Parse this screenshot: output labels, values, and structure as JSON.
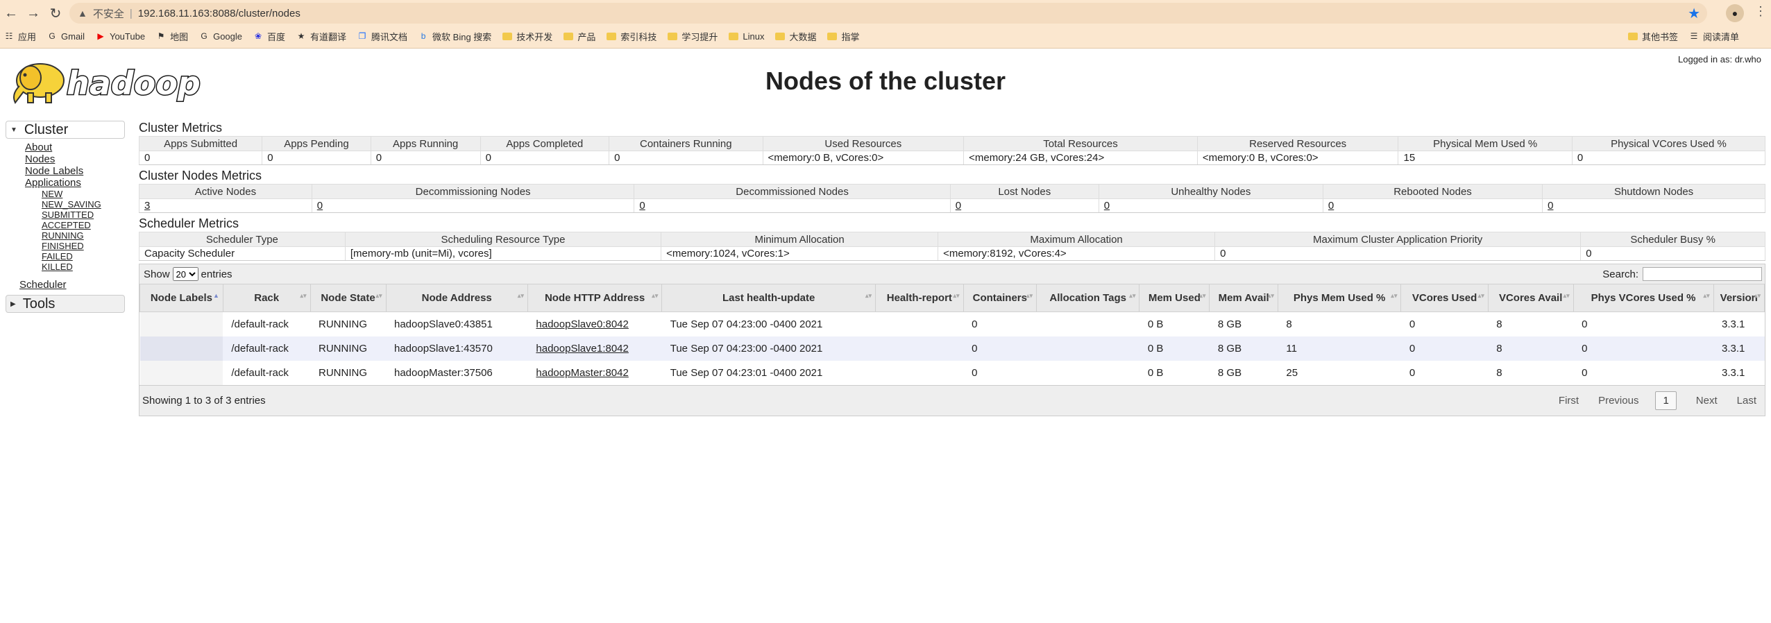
{
  "browser": {
    "insecure_label": "不安全",
    "url": "192.168.11.163:8088/cluster/nodes",
    "bookmarks": [
      {
        "icon": "apps-grid-icon",
        "label": "应用"
      },
      {
        "icon": "google-g-icon",
        "label": "Gmail"
      },
      {
        "icon": "youtube-icon",
        "label": "YouTube"
      },
      {
        "icon": "map-icon",
        "label": "地图"
      },
      {
        "icon": "google-g-icon",
        "label": "Google"
      },
      {
        "icon": "baidu-icon",
        "label": "百度"
      },
      {
        "icon": "youdao-icon",
        "label": "有道翻译"
      },
      {
        "icon": "tencent-docs-icon",
        "label": "腾讯文档"
      },
      {
        "icon": "bing-icon",
        "label": "微软 Bing 搜索"
      },
      {
        "icon": "folder-icon",
        "label": "技术开发"
      },
      {
        "icon": "folder-icon",
        "label": "产品"
      },
      {
        "icon": "folder-icon",
        "label": "索引科技"
      },
      {
        "icon": "folder-icon",
        "label": "学习提升"
      },
      {
        "icon": "folder-icon",
        "label": "Linux"
      },
      {
        "icon": "folder-icon",
        "label": "大数据"
      },
      {
        "icon": "folder-icon",
        "label": "指掌"
      }
    ],
    "bookmarks_right": [
      {
        "icon": "folder-icon",
        "label": "其他书签"
      },
      {
        "icon": "reading-list-icon",
        "label": "阅读清单"
      }
    ]
  },
  "header": {
    "logo_text": "hadoop",
    "title": "Nodes of the cluster",
    "logged_in": "Logged in as: dr.who"
  },
  "sidebar": {
    "cluster_label": "Cluster",
    "links": [
      "About",
      "Nodes",
      "Node Labels",
      "Applications"
    ],
    "app_states": [
      "NEW",
      "NEW_SAVING",
      "SUBMITTED",
      "ACCEPTED",
      "RUNNING",
      "FINISHED",
      "FAILED",
      "KILLED"
    ],
    "scheduler_label": "Scheduler",
    "tools_label": "Tools"
  },
  "cluster_metrics": {
    "title": "Cluster Metrics",
    "headers": [
      "Apps Submitted",
      "Apps Pending",
      "Apps Running",
      "Apps Completed",
      "Containers Running",
      "Used Resources",
      "Total Resources",
      "Reserved Resources",
      "Physical Mem Used %",
      "Physical VCores Used %"
    ],
    "values": [
      "0",
      "0",
      "0",
      "0",
      "0",
      "<memory:0 B, vCores:0>",
      "<memory:24 GB, vCores:24>",
      "<memory:0 B, vCores:0>",
      "15",
      "0"
    ]
  },
  "cluster_nodes_metrics": {
    "title": "Cluster Nodes Metrics",
    "headers": [
      "Active Nodes",
      "Decommissioning Nodes",
      "Decommissioned Nodes",
      "Lost Nodes",
      "Unhealthy Nodes",
      "Rebooted Nodes",
      "Shutdown Nodes"
    ],
    "values": [
      "3",
      "0",
      "0",
      "0",
      "0",
      "0",
      "0"
    ]
  },
  "scheduler_metrics": {
    "title": "Scheduler Metrics",
    "headers": [
      "Scheduler Type",
      "Scheduling Resource Type",
      "Minimum Allocation",
      "Maximum Allocation",
      "Maximum Cluster Application Priority",
      "Scheduler Busy %"
    ],
    "values": [
      "Capacity Scheduler",
      "[memory-mb (unit=Mi), vcores]",
      "<memory:1024, vCores:1>",
      "<memory:8192, vCores:4>",
      "0",
      "0"
    ]
  },
  "nodes_table": {
    "show_label": "Show",
    "page_size": "20",
    "entries_label": "entries",
    "search_label": "Search:",
    "search_value": "",
    "columns": [
      "Node Labels",
      "Rack",
      "Node State",
      "Node Address",
      "Node HTTP Address",
      "Last health-update",
      "Health-report",
      "Containers",
      "Allocation Tags",
      "Mem Used",
      "Mem Avail",
      "Phys Mem Used %",
      "VCores Used",
      "VCores Avail",
      "Phys VCores Used %",
      "Version"
    ],
    "rows": [
      [
        "",
        "/default-rack",
        "RUNNING",
        "hadoopSlave0:43851",
        "hadoopSlave0:8042",
        "Tue Sep 07 04:23:00 -0400 2021",
        "",
        "0",
        "",
        "0 B",
        "8 GB",
        "8",
        "0",
        "8",
        "0",
        "3.3.1"
      ],
      [
        "",
        "/default-rack",
        "RUNNING",
        "hadoopSlave1:43570",
        "hadoopSlave1:8042",
        "Tue Sep 07 04:23:00 -0400 2021",
        "",
        "0",
        "",
        "0 B",
        "8 GB",
        "11",
        "0",
        "8",
        "0",
        "3.3.1"
      ],
      [
        "",
        "/default-rack",
        "RUNNING",
        "hadoopMaster:37506",
        "hadoopMaster:8042",
        "Tue Sep 07 04:23:01 -0400 2021",
        "",
        "0",
        "",
        "0 B",
        "8 GB",
        "25",
        "0",
        "8",
        "0",
        "3.3.1"
      ]
    ],
    "info": "Showing 1 to 3 of 3 entries",
    "pager": {
      "first": "First",
      "previous": "Previous",
      "current": "1",
      "next": "Next",
      "last": "Last"
    }
  },
  "colors": {
    "chrome_bg": "#fbe7cf",
    "header_bg": "#eeeeee",
    "even_row_bg": "#eef0fa"
  }
}
